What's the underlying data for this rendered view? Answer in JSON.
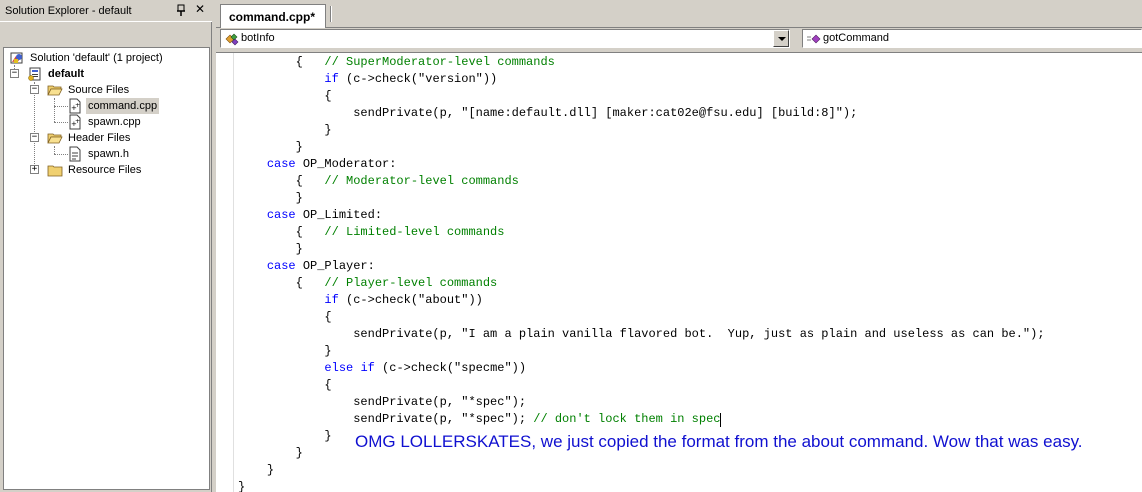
{
  "solution_explorer": {
    "title": "Solution Explorer - default",
    "pin_icon": "pushpin-icon",
    "close_icon": "close-icon",
    "toolbar": {
      "properties_icon": "properties-icon"
    },
    "tree": {
      "solution": "Solution 'default' (1 project)",
      "project": "default",
      "source_files": "Source Files",
      "command_cpp": "command.cpp",
      "spawn_cpp": "spawn.cpp",
      "header_files": "Header Files",
      "spawn_h": "spawn.h",
      "resource_files": "Resource Files"
    }
  },
  "editor": {
    "tab_label": "command.cpp*",
    "class_combo": {
      "value": "botInfo",
      "icon": "class-icon"
    },
    "member_combo": {
      "value": "gotCommand",
      "icon": "method-icon"
    },
    "code_lines": [
      {
        "indent": "        ",
        "segments": [
          {
            "t": "{   ",
            "c": ""
          },
          {
            "t": "// SuperModerator-level commands",
            "c": "cm"
          }
        ]
      },
      {
        "indent": "            ",
        "segments": [
          {
            "t": "if",
            "c": "kw"
          },
          {
            "t": " (c->check(\"version\"))",
            "c": ""
          }
        ]
      },
      {
        "indent": "            ",
        "segments": [
          {
            "t": "{",
            "c": ""
          }
        ]
      },
      {
        "indent": "                ",
        "segments": [
          {
            "t": "sendPrivate(p, \"[name:default.dll] [maker:cat02e@fsu.edu] [build:8]\");",
            "c": ""
          }
        ]
      },
      {
        "indent": "            ",
        "segments": [
          {
            "t": "}",
            "c": ""
          }
        ]
      },
      {
        "indent": "        ",
        "segments": [
          {
            "t": "}",
            "c": ""
          }
        ]
      },
      {
        "indent": "    ",
        "segments": [
          {
            "t": "case",
            "c": "kw"
          },
          {
            "t": " OP_Moderator:",
            "c": ""
          }
        ]
      },
      {
        "indent": "        ",
        "segments": [
          {
            "t": "{   ",
            "c": ""
          },
          {
            "t": "// Moderator-level commands",
            "c": "cm"
          }
        ]
      },
      {
        "indent": "        ",
        "segments": [
          {
            "t": "}",
            "c": ""
          }
        ]
      },
      {
        "indent": "    ",
        "segments": [
          {
            "t": "case",
            "c": "kw"
          },
          {
            "t": " OP_Limited:",
            "c": ""
          }
        ]
      },
      {
        "indent": "        ",
        "segments": [
          {
            "t": "{   ",
            "c": ""
          },
          {
            "t": "// Limited-level commands",
            "c": "cm"
          }
        ]
      },
      {
        "indent": "        ",
        "segments": [
          {
            "t": "}",
            "c": ""
          }
        ]
      },
      {
        "indent": "    ",
        "segments": [
          {
            "t": "case",
            "c": "kw"
          },
          {
            "t": " OP_Player:",
            "c": ""
          }
        ]
      },
      {
        "indent": "        ",
        "segments": [
          {
            "t": "{   ",
            "c": ""
          },
          {
            "t": "// Player-level commands",
            "c": "cm"
          }
        ]
      },
      {
        "indent": "            ",
        "segments": [
          {
            "t": "if",
            "c": "kw"
          },
          {
            "t": " (c->check(\"about\"))",
            "c": ""
          }
        ]
      },
      {
        "indent": "            ",
        "segments": [
          {
            "t": "{",
            "c": ""
          }
        ]
      },
      {
        "indent": "                ",
        "segments": [
          {
            "t": "sendPrivate(p, \"I am a plain vanilla flavored bot.  Yup, just as plain and useless as can be.\");",
            "c": ""
          }
        ]
      },
      {
        "indent": "            ",
        "segments": [
          {
            "t": "}",
            "c": ""
          }
        ]
      },
      {
        "indent": "            ",
        "segments": [
          {
            "t": "else",
            "c": "kw"
          },
          {
            "t": " ",
            "c": ""
          },
          {
            "t": "if",
            "c": "kw"
          },
          {
            "t": " (c->check(\"specme\"))",
            "c": ""
          }
        ]
      },
      {
        "indent": "            ",
        "segments": [
          {
            "t": "{",
            "c": ""
          }
        ]
      },
      {
        "indent": "                ",
        "segments": [
          {
            "t": "sendPrivate(p, \"*spec\");",
            "c": ""
          }
        ]
      },
      {
        "indent": "                ",
        "segments": [
          {
            "t": "sendPrivate(p, \"*spec\"); ",
            "c": ""
          },
          {
            "t": "// don't lock them in spec",
            "c": "cm"
          }
        ]
      },
      {
        "indent": "            ",
        "segments": [
          {
            "t": "}",
            "c": ""
          }
        ]
      },
      {
        "indent": "        ",
        "segments": [
          {
            "t": "}",
            "c": ""
          }
        ]
      },
      {
        "indent": "    ",
        "segments": [
          {
            "t": "}",
            "c": ""
          }
        ]
      },
      {
        "indent": "",
        "segments": [
          {
            "t": "}",
            "c": ""
          }
        ]
      }
    ],
    "annotation": "OMG LOLLERSKATES, we just copied the format from the about command. Wow that was easy."
  },
  "colors": {
    "keyword": "#0000ff",
    "comment": "#008000",
    "annotation": "#1010d0",
    "chrome": "#d4d0c8"
  }
}
